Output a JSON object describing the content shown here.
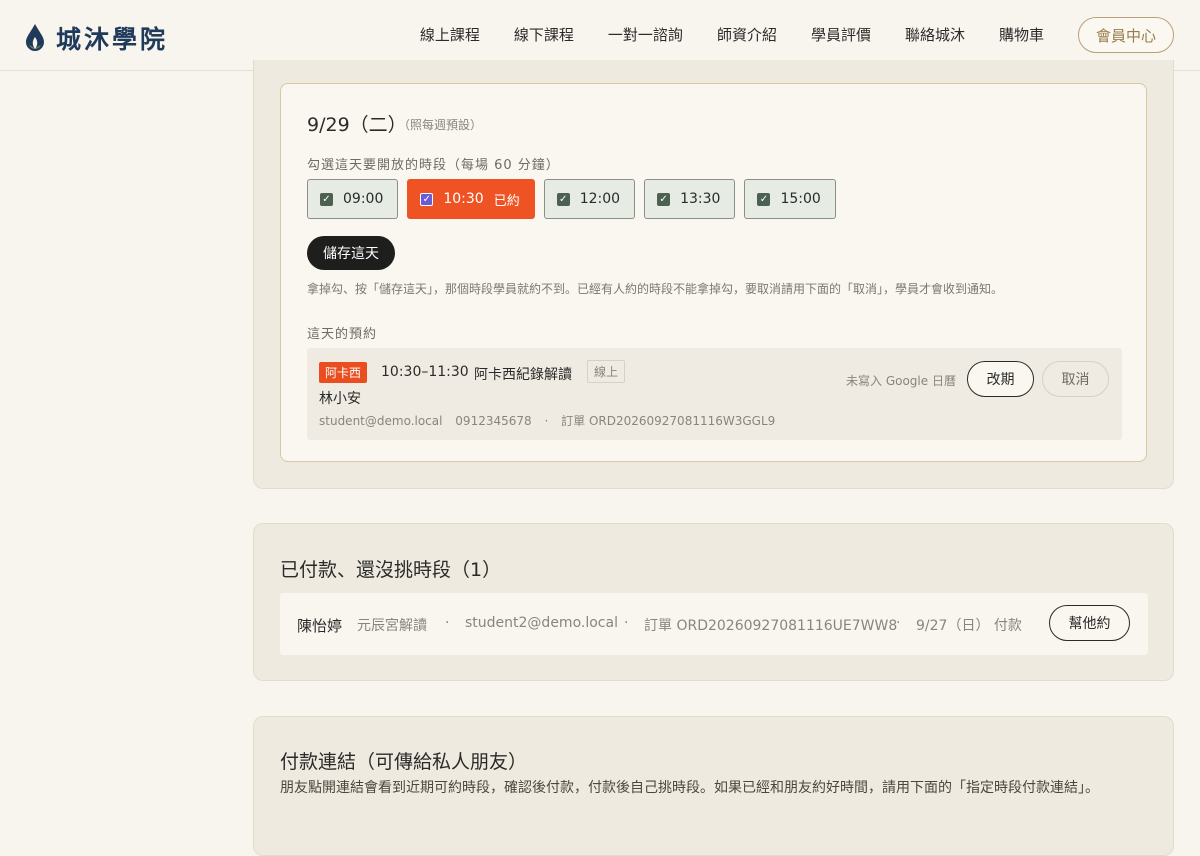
{
  "brand": {
    "name": "城沐學院",
    "color": "#1f3a5a"
  },
  "nav": [
    "線上課程",
    "線下課程",
    "一對一諮詢",
    "師資介紹",
    "學員評價",
    "聯絡城沐",
    "購物車"
  ],
  "member_center": "會員中心",
  "day": {
    "title": "9/29（二）",
    "note": "（照每週預設）",
    "slots_label": "勾選這天要開放的時段（每場 60 分鐘）",
    "slots": [
      {
        "time": "09:00",
        "checked": true,
        "booked": false,
        "tag": ""
      },
      {
        "time": "10:30",
        "checked": true,
        "booked": true,
        "tag": "已約"
      },
      {
        "time": "12:00",
        "checked": true,
        "booked": false,
        "tag": ""
      },
      {
        "time": "13:30",
        "checked": true,
        "booked": false,
        "tag": ""
      },
      {
        "time": "15:00",
        "checked": true,
        "booked": false,
        "tag": ""
      }
    ],
    "save_label": "儲存這天",
    "hint": "拿掉勾、按「儲存這天」，那個時段學員就約不到。已經有人約的時段不能拿掉勾，要取消請用下面的「取消」，學員才會收到通知。",
    "bookings_label": "這天的預約",
    "booking": {
      "teacher": "阿卡西",
      "time": "10:30–11:30",
      "course": "阿卡西紀錄解讀",
      "mode": "線上",
      "student": "林小安",
      "email": "student@demo.local",
      "phone": "0912345678",
      "sep": "·",
      "order": "訂單 ORD20260927081116W3GGL9",
      "gcal": "未寫入 Google 日曆",
      "reschedule": "改期",
      "cancel": "取消"
    }
  },
  "unpaid": {
    "title": "已付款、還沒挑時段（1）",
    "row": {
      "name": "陳怡婷",
      "course": "元辰宮解讀",
      "email": "student2@demo.local",
      "order": "訂單 ORD20260927081116UE7WW8",
      "paid": "9/27（日） 付款",
      "sep": "·",
      "action": "幫他約"
    }
  },
  "paylink": {
    "title": "付款連結（可傳給私人朋友）",
    "desc": "朋友點開連結會看到近期可約時段，確認後付款，付款後自己挑時段。如果已經和朋友約好時間，請用下面的「指定時段付款連結」。"
  },
  "colors": {
    "accent": "#ef5323",
    "dark_button": "#1e1e1c",
    "check": "#4d6153"
  }
}
